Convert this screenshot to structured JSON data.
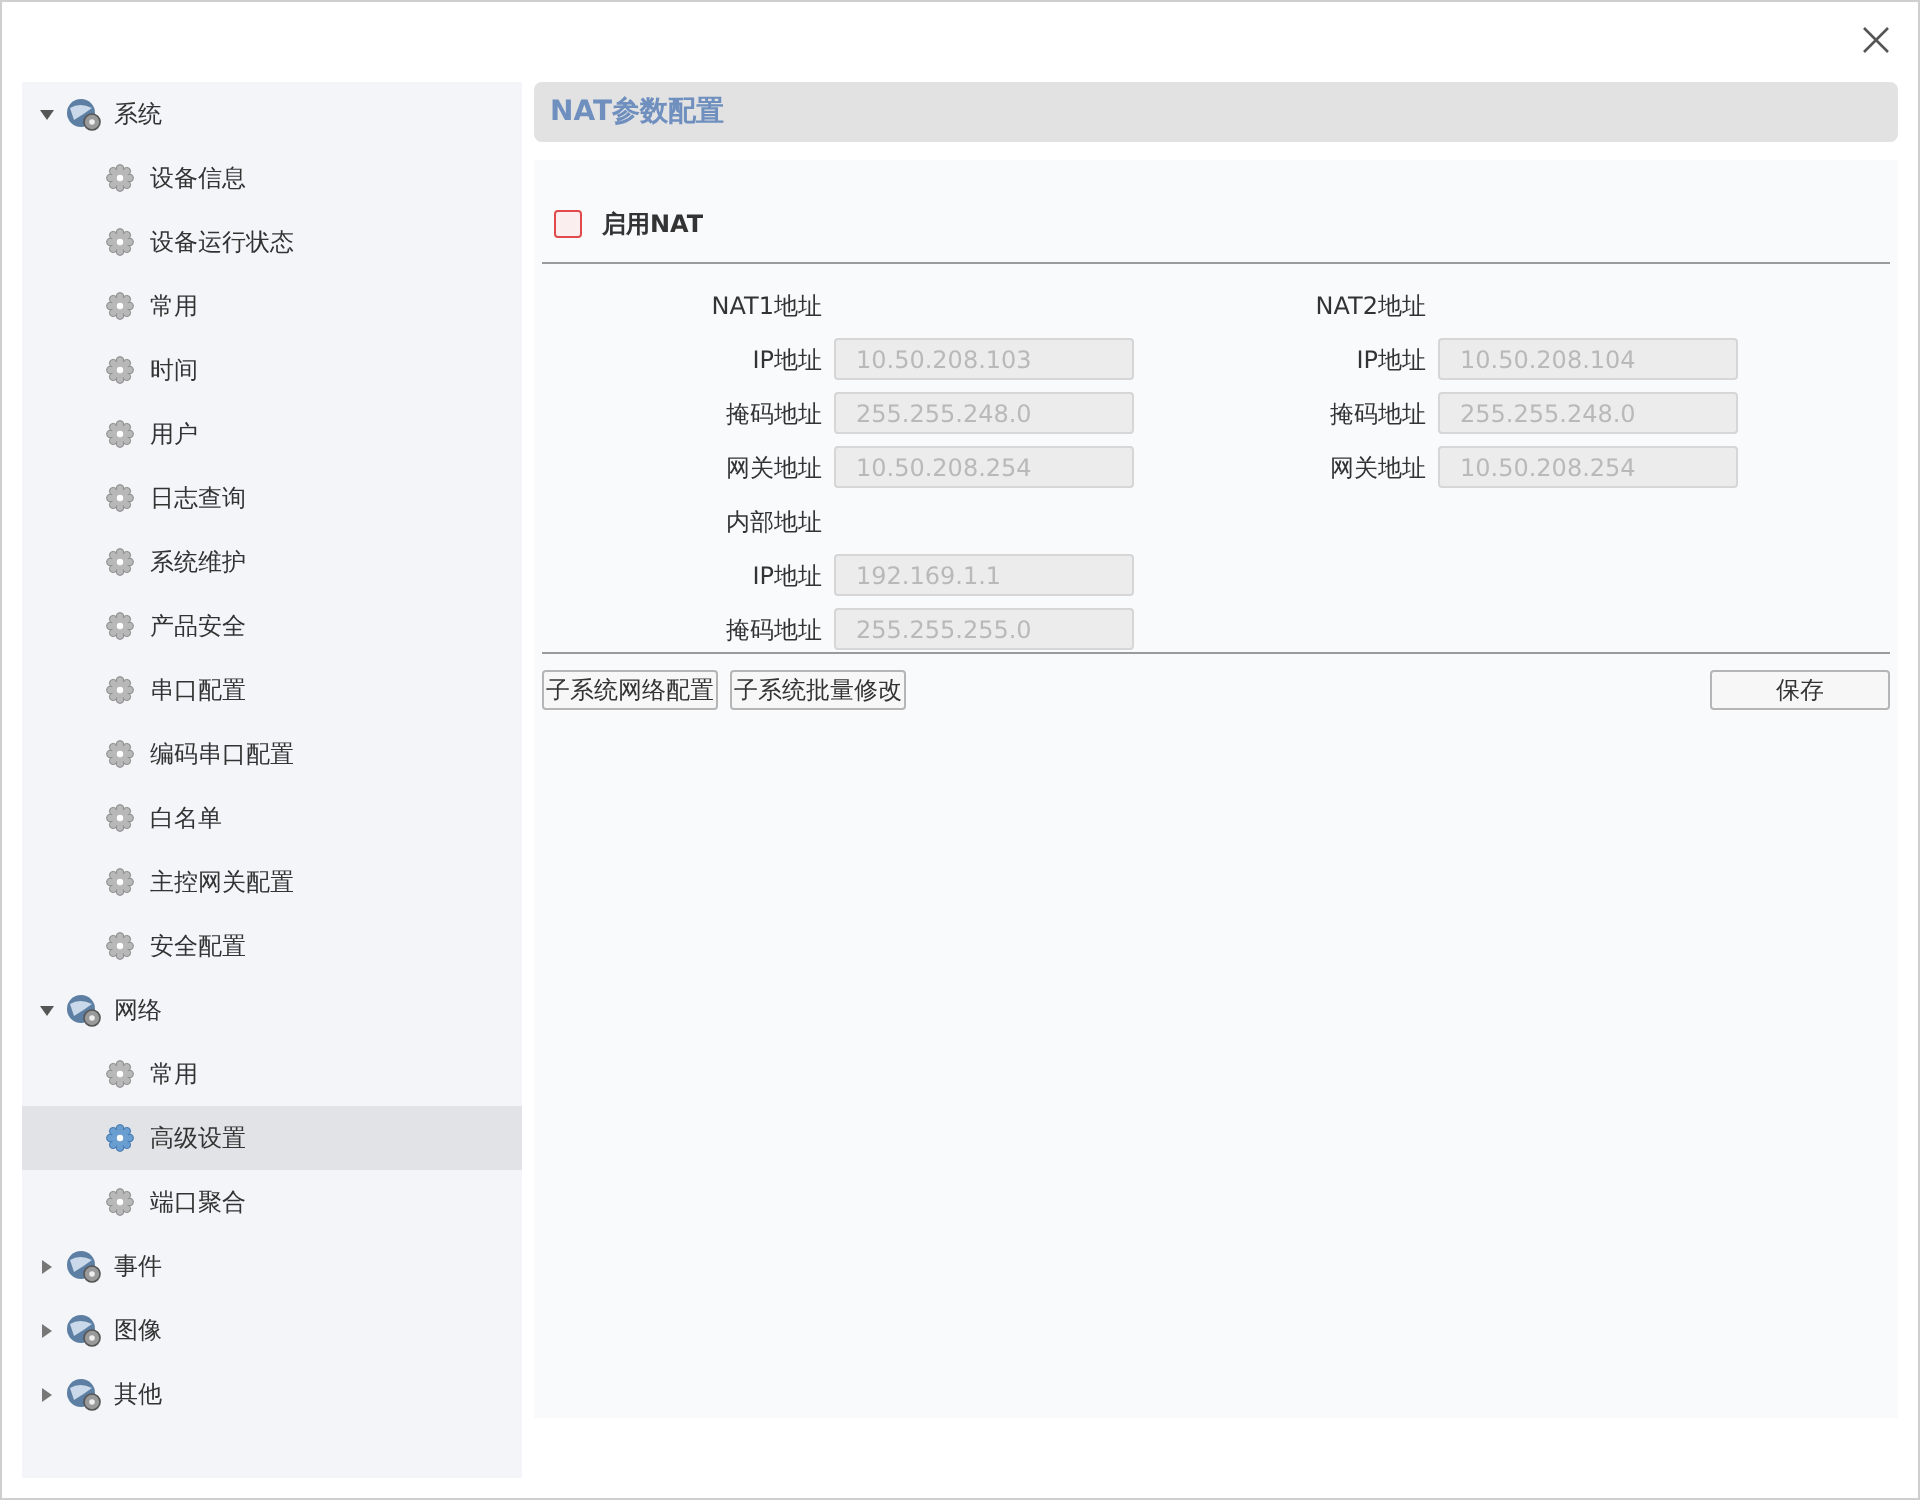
{
  "sidebar": {
    "groups": [
      {
        "label": "系统",
        "expanded": true,
        "children": [
          {
            "label": "设备信息",
            "selected": false
          },
          {
            "label": "设备运行状态",
            "selected": false
          },
          {
            "label": "常用",
            "selected": false
          },
          {
            "label": "时间",
            "selected": false
          },
          {
            "label": "用户",
            "selected": false
          },
          {
            "label": "日志查询",
            "selected": false
          },
          {
            "label": "系统维护",
            "selected": false
          },
          {
            "label": "产品安全",
            "selected": false
          },
          {
            "label": "串口配置",
            "selected": false
          },
          {
            "label": "编码串口配置",
            "selected": false
          },
          {
            "label": "白名单",
            "selected": false
          },
          {
            "label": "主控网关配置",
            "selected": false
          },
          {
            "label": "安全配置",
            "selected": false
          }
        ]
      },
      {
        "label": "网络",
        "expanded": true,
        "children": [
          {
            "label": "常用",
            "selected": false
          },
          {
            "label": "高级设置",
            "selected": true
          },
          {
            "label": "端口聚合",
            "selected": false
          }
        ]
      },
      {
        "label": "事件",
        "expanded": false
      },
      {
        "label": "图像",
        "expanded": false
      },
      {
        "label": "其他",
        "expanded": false
      }
    ]
  },
  "panel": {
    "title": "NAT参数配置",
    "enable_nat": {
      "label": "启用NAT",
      "checked": false
    },
    "nat1": {
      "heading": "NAT1地址",
      "fields": [
        {
          "label": "IP地址",
          "value": "10.50.208.103"
        },
        {
          "label": "掩码地址",
          "value": "255.255.248.0"
        },
        {
          "label": "网关地址",
          "value": "10.50.208.254"
        }
      ]
    },
    "nat2": {
      "heading": "NAT2地址",
      "fields": [
        {
          "label": "IP地址",
          "value": "10.50.208.104"
        },
        {
          "label": "掩码地址",
          "value": "255.255.248.0"
        },
        {
          "label": "网关地址",
          "value": "10.50.208.254"
        }
      ]
    },
    "internal": {
      "heading": "内部地址",
      "fields": [
        {
          "label": "IP地址",
          "value": "192.169.1.1"
        },
        {
          "label": "掩码地址",
          "value": "255.255.255.0"
        }
      ]
    },
    "buttons": [
      "子系统网络配置",
      "子系统批量修改"
    ],
    "save_button": "保存"
  }
}
